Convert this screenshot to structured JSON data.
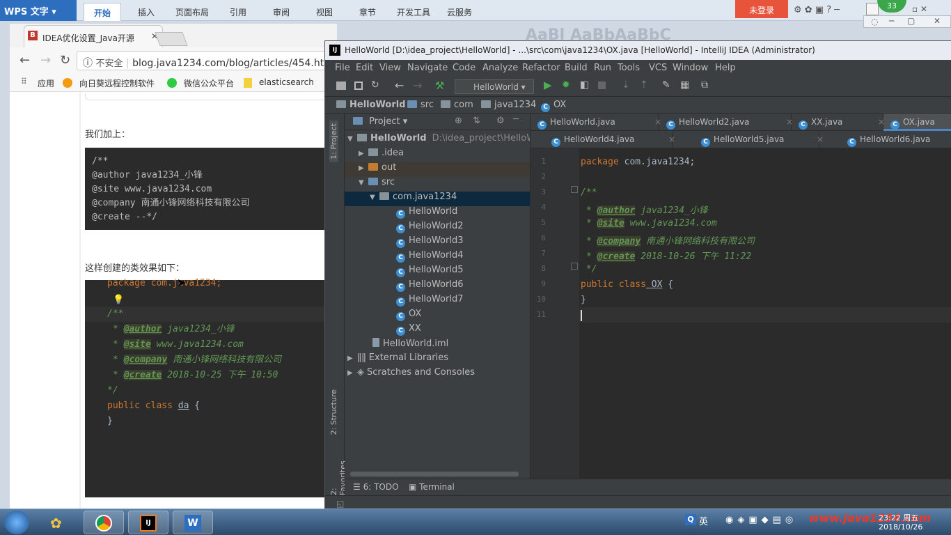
{
  "wps": {
    "app_name": "WPS 文字",
    "tabs": [
      "开始",
      "插入",
      "页面布局",
      "引用",
      "审阅",
      "视图",
      "章节",
      "开发工具",
      "云服务"
    ],
    "login": "未登录",
    "bg_title": "AaBl AaBbAaBbC"
  },
  "recorder": {
    "ime": "英",
    "badge": "33"
  },
  "chrome": {
    "tab_title": "IDEA优化设置_Java开源",
    "tab_favicon": "B",
    "insecure_label": "不安全",
    "url": "blog.java1234.com/blog/articles/454.htm",
    "bookmarks": [
      "应用",
      "向日葵远程控制软件",
      "微信公众平台",
      "elasticsearch"
    ],
    "page": {
      "text1": "我们加上：",
      "block1": [
        "/**",
        "@author java1234_小锋",
        "@site www.java1234.com",
        "@company 南通小锋网络科技有限公司",
        "@create  --*/"
      ],
      "text2": "这样创建的类效果如下：",
      "block2": {
        "line1": "package com.java1234;",
        "line2": "/**",
        "author_tag": "@author",
        "author_val": " java1234_小锋",
        "site_tag": "@site",
        "site_val": " www.java1234.com",
        "company_tag": "@company",
        "company_val": " 南通小锋网络科技有限公司",
        "create_tag": "@create",
        "create_val": " 2018-10-25 下午 10:50",
        "close": " */",
        "class_kw": "public class ",
        "class_name": "da",
        "class_open": " {",
        "class_close": "}"
      }
    }
  },
  "idea": {
    "title": "HelloWorld [D:\\idea_project\\HelloWorld] - ...\\src\\com\\java1234\\OX.java [HelloWorld] - IntelliJ IDEA (Administrator)",
    "menu": [
      "File",
      "Edit",
      "View",
      "Navigate",
      "Code",
      "Analyze",
      "Refactor",
      "Build",
      "Run",
      "Tools",
      "VCS",
      "Window",
      "Help"
    ],
    "run_config": "HelloWorld",
    "breadcrumb": [
      "HelloWorld",
      "src",
      "com",
      "java1234",
      "OX"
    ],
    "side_labels": [
      "1: Project",
      "2: Structure",
      "2: Favorites"
    ],
    "project_panel_title": "Project",
    "tree": {
      "root": "HelloWorld",
      "root_path": "D:\\idea_project\\HelloWorld",
      "idea": ".idea",
      "out": "out",
      "src": "src",
      "pkg": "com.java1234",
      "classes": [
        "HelloWorld",
        "HelloWorld2",
        "HelloWorld3",
        "HelloWorld4",
        "HelloWorld5",
        "HelloWorld6",
        "HelloWorld7",
        "OX",
        "XX"
      ],
      "iml": "HelloWorld.iml",
      "ext_libs": "External Libraries",
      "scratches": "Scratches and Consoles"
    },
    "editor_tabs_row1": [
      "HelloWorld.java",
      "HelloWorld2.java",
      "XX.java",
      "OX.java"
    ],
    "editor_tabs_row2": [
      "HelloWorld4.java",
      "HelloWorld5.java",
      "HelloWorld6.java"
    ],
    "line_numbers": [
      "1",
      "2",
      "3",
      "4",
      "5",
      "6",
      "7",
      "8",
      "9",
      "10",
      "11"
    ],
    "code": {
      "pkg_kw": "package",
      "pkg_name": " com.java1234;",
      "doc_open": "/**",
      "author_tag": "@author",
      "author_val": " java1234_小锋",
      "site_tag": "@site",
      "site_val": " www.java1234.com",
      "company_tag": "@company",
      "company_val": " 南通小锋网络科技有限公司",
      "create_tag": "@create",
      "create_val": " 2018-10-26 下午 11:22",
      "doc_close": " */",
      "class_kw": "public class",
      "class_name": " OX",
      "class_open": " {",
      "class_close": "}"
    },
    "bottom_tabs": [
      "6: TODO",
      "Terminal"
    ]
  },
  "taskbar": {
    "ime": "英",
    "watermark": "www.java1234.com",
    "time": "23:22 周五",
    "date": "2018/10/26"
  },
  "colors": {
    "accent": "#4a88c7",
    "wps_blue": "#2d6fbe",
    "record_orange": "#f07a1c"
  }
}
